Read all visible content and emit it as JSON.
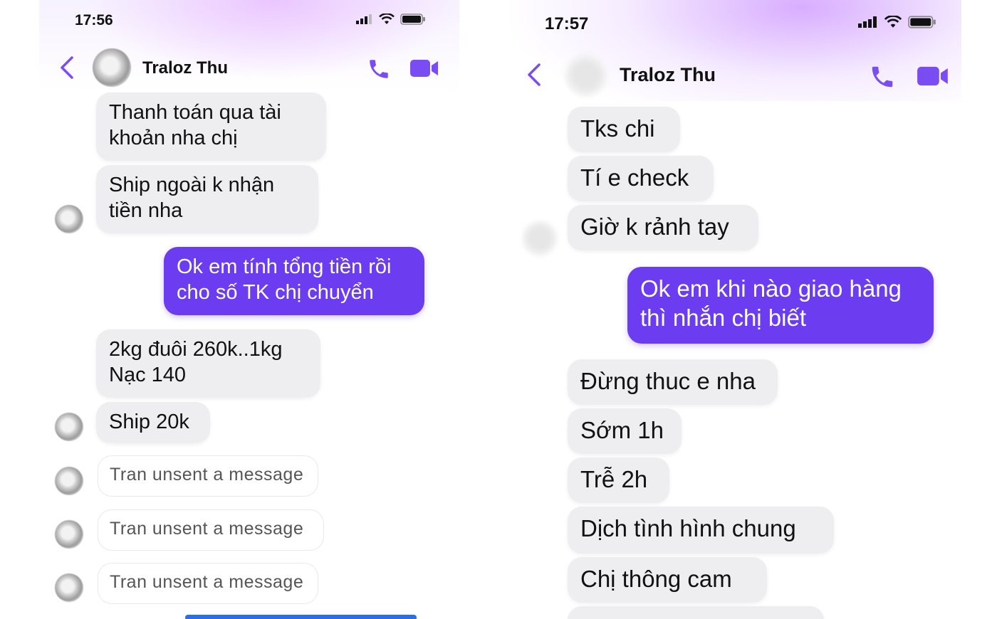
{
  "left": {
    "time": "17:56",
    "contact_name": "Traloz Thu",
    "messages": [
      "Thanh  toán  qua  tài\nkhoản nha  chị",
      "Ship  ngoài  k nhận\ntiền  nha",
      "Ok em tính tổng tiền rồi\ncho số TK chị chuyển",
      "2kg  đuôi 260k..1kg\nNạc 140",
      "Ship 20k",
      "Tran unsent a message",
      "Tran unsent a message",
      "Tran unsent a message"
    ]
  },
  "right": {
    "time": "17:57",
    "contact_name": "Traloz Thu",
    "messages": [
      "Tks  chi",
      "Tí  e check",
      "Giờ  k rảnh  tay",
      "Ok em khi nào giao hàng\nthì nhắn chị biết",
      "Đừng thuc e nha",
      "Sớm  1h",
      "Trễ  2h",
      "Dịch  tình hình  chung",
      "Chị  thông  cam"
    ]
  },
  "colors": {
    "accent": "#6b3cf0",
    "incoming_bubble": "#eeeef0",
    "header_tint": "#d6a8ff"
  },
  "icons": [
    "back-arrow-icon",
    "phone-icon",
    "video-camera-icon",
    "signal-icon",
    "wifi-icon",
    "battery-icon",
    "avatar"
  ]
}
